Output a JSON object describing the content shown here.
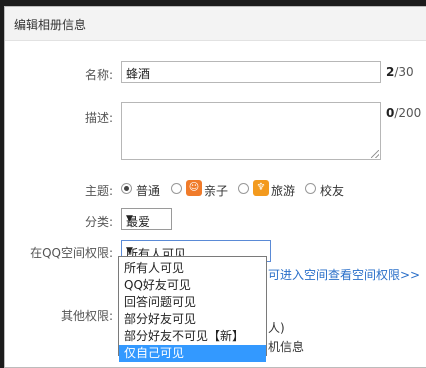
{
  "dialog": {
    "title": "编辑相册信息"
  },
  "name": {
    "label": "名称:",
    "value": "蜂酒",
    "count": "2",
    "max": "/30"
  },
  "desc": {
    "label": "描述:",
    "value": "",
    "count": "0",
    "max": "/200"
  },
  "theme": {
    "label": "主题:",
    "options": [
      {
        "label": "普通",
        "selected": true,
        "icon": ""
      },
      {
        "label": "亲子",
        "selected": false,
        "icon": "baby-face-icon",
        "color": "#f07b2a"
      },
      {
        "label": "旅游",
        "selected": false,
        "icon": "palm-tree-icon",
        "color": "#f39a1e"
      },
      {
        "label": "校友",
        "selected": false,
        "icon": ""
      }
    ]
  },
  "category": {
    "label": "分类:",
    "value": "最爱"
  },
  "qzone": {
    "label": "在QQ空间权限:",
    "value": "所有人可见",
    "options": [
      "所有人可见",
      "QQ好友可见",
      "回答问题可见",
      "部分好友可见",
      "部分好友不可见【新】",
      "仅自己可见"
    ],
    "selected_index": 5
  },
  "links": {
    "access": "可进入空间",
    "view": "查看空间权限>>"
  },
  "other": {
    "label": "其他权限:",
    "partial1": "人)",
    "partial2": "机信息"
  }
}
